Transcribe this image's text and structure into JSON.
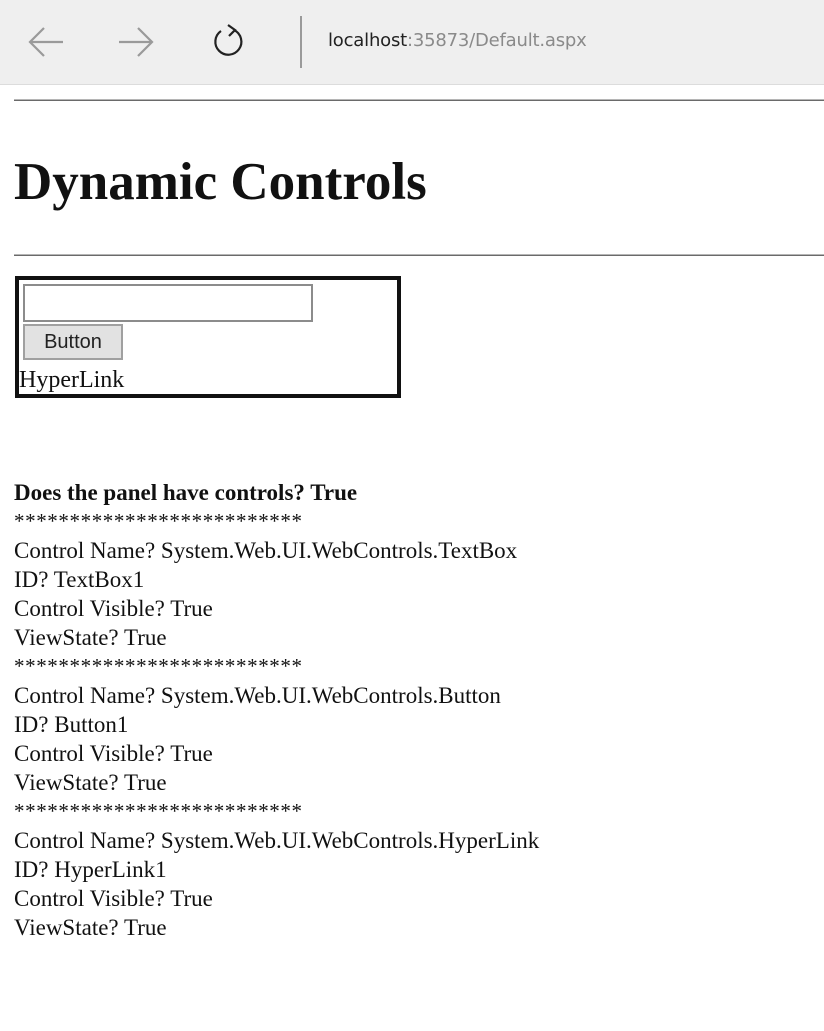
{
  "browser": {
    "back_icon": "back-arrow-icon",
    "forward_icon": "forward-arrow-icon",
    "refresh_icon": "refresh-icon",
    "address_host": "localhost",
    "address_path": ":35873/Default.aspx"
  },
  "page": {
    "title": "Dynamic Controls"
  },
  "panel": {
    "textbox_value": "",
    "button_label": "Button",
    "hyperlink_text": "HyperLink"
  },
  "output": {
    "header": "Does the panel have controls? True",
    "separator": "**************************",
    "controls": [
      {
        "name": "Control Name? System.Web.UI.WebControls.TextBox",
        "id": "ID? TextBox1",
        "visible": "Control Visible? True",
        "viewstate": "ViewState? True"
      },
      {
        "name": "Control Name? System.Web.UI.WebControls.Button",
        "id": "ID? Button1",
        "visible": "Control Visible? True",
        "viewstate": "ViewState? True"
      },
      {
        "name": "Control Name? System.Web.UI.WebControls.HyperLink",
        "id": "ID? HyperLink1",
        "visible": "Control Visible? True",
        "viewstate": "ViewState? True"
      }
    ]
  }
}
